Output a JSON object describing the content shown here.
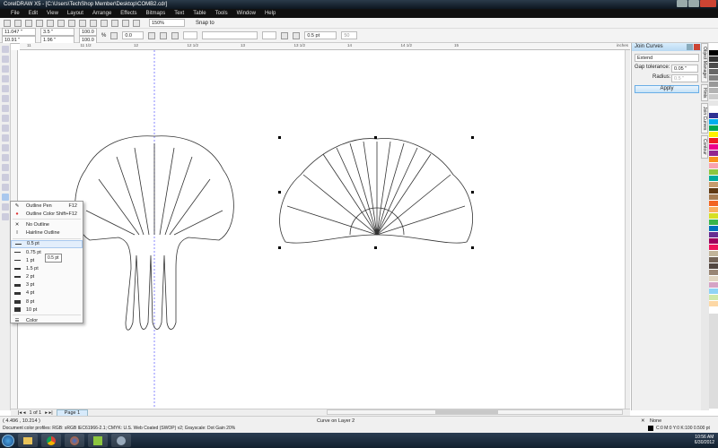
{
  "window": {
    "title": "CorelDRAW X5 - [C:\\Users\\TechShop Member\\Desktop\\COMB2.cdr]"
  },
  "menu": [
    "File",
    "Edit",
    "View",
    "Layout",
    "Arrange",
    "Effects",
    "Bitmaps",
    "Text",
    "Table",
    "Tools",
    "Window",
    "Help"
  ],
  "toolbar": {
    "zoom": "150%",
    "snap_to": "Snap to"
  },
  "property_bar": {
    "x": "11.047 \"",
    "y": "10.91 \"",
    "width": "3.5 \"",
    "height": "1.96 \"",
    "scale_x": "100.0",
    "scale_y": "100.0",
    "pct": "%",
    "rotation": "0.0",
    "outline_width": "0.5 pt",
    "num": "50"
  },
  "ruler": {
    "units": "inches",
    "ticks": [
      "11",
      "11 1/2",
      "12",
      "12 1/2",
      "13",
      "13 1/2",
      "14",
      "14 1/2",
      "15"
    ]
  },
  "outline_menu": {
    "items": [
      {
        "label": "Outline Pen",
        "shortcut": "F12",
        "icon": "pen-nib-icon"
      },
      {
        "label": "Outline Color",
        "shortcut": "Shift+F12",
        "icon": "color-wheel-icon"
      },
      {
        "label": "No Outline",
        "icon": "x-icon"
      },
      {
        "label": "Hairline Outline",
        "icon": "hairline-icon"
      }
    ],
    "widths": [
      "0.5 pt",
      "0.75 pt",
      "1 pt",
      "1.5 pt",
      "2 pt",
      "3 pt",
      "4 pt",
      "8 pt",
      "10 pt"
    ],
    "selected_width": "0.5 pt",
    "color_label": "Color",
    "tooltip": "0.5 pt"
  },
  "docker": {
    "title": "Join Curves",
    "mode": "Extend",
    "gap_label": "Gap tolerance:",
    "gap_value": "0.05 \"",
    "radius_label": "Radius:",
    "radius_value": "0.5 \"",
    "apply": "Apply",
    "tabs": [
      "Object Manager",
      "Hints",
      "Join Curves",
      "Contour"
    ]
  },
  "palette": [
    "#000000",
    "#333333",
    "#4d4d4d",
    "#666666",
    "#808080",
    "#999999",
    "#b3b3b3",
    "#cccccc",
    "#e6e6e6",
    "#ffffff",
    "#2e3192",
    "#00aeef",
    "#00a651",
    "#fff200",
    "#ed1c24",
    "#ec008c",
    "#92278f",
    "#f7941d",
    "#f9a3b0",
    "#8dc63f",
    "#00a99d",
    "#c69c6d",
    "#603913",
    "#a67c52",
    "#f26522",
    "#fbaf5d",
    "#d7df23",
    "#39b54a",
    "#0072bc",
    "#662d91",
    "#9e005d",
    "#ed145b",
    "#c2b59b",
    "#736357",
    "#534741",
    "#998675",
    "#e1d5c1",
    "#d5a3c5",
    "#8fd3f5",
    "#cfe8a9",
    "#fdd8a5",
    "#ffffff"
  ],
  "page_nav": {
    "counter": "1 of 1",
    "page_tab": "Page 1"
  },
  "status": {
    "coords": "( 4.496 , 10.214 )",
    "message": "Curve on Layer 2",
    "fill": "None",
    "outline": "C:0 M:0 Y:0 K:100  0.500 pt",
    "profiles": "Document color profiles: RGB: sRGB IEC61966-2.1; CMYK: U.S. Web Coated (SWOP) v2; Grayscale: Dot Gain 20%"
  },
  "clock": {
    "time": "10:56 AM",
    "date": "6/30/2012"
  }
}
